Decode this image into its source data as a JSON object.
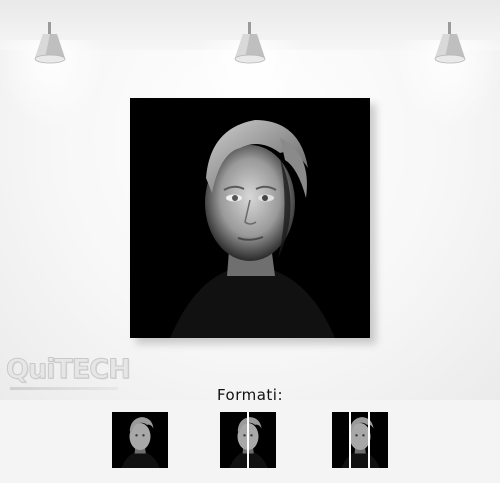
{
  "logo": {
    "text": "QuiTECH"
  },
  "formats": {
    "label": "Formati:",
    "options": [
      {
        "name": "single-panel",
        "panels": 1
      },
      {
        "name": "two-panels",
        "panels": 2
      },
      {
        "name": "three-panels",
        "panels": 3
      }
    ]
  },
  "artwork": {
    "subject": "black-and-white portrait of a man"
  },
  "colors": {
    "wall": "#f7f7f7",
    "canvas": "#000000",
    "accent_text": "#111111"
  },
  "icons": [
    "spotlight-icon",
    "spotlight-icon",
    "spotlight-icon"
  ]
}
